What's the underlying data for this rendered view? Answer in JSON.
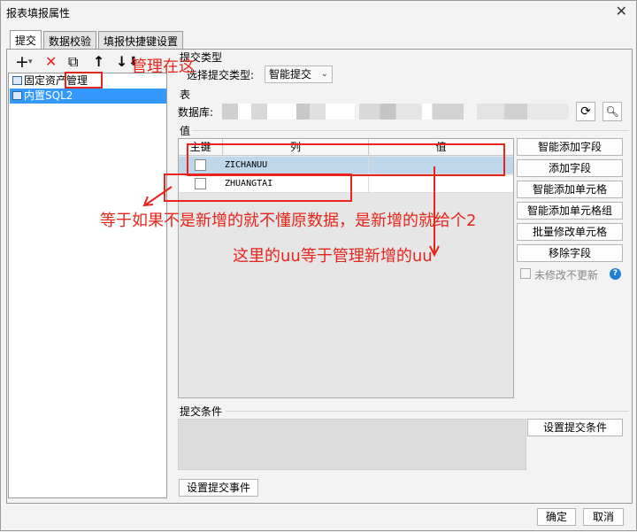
{
  "window": {
    "title": "报表填报属性",
    "close_icon": "✕"
  },
  "tabs": [
    "提交",
    "数据校验",
    "填报快捷键设置"
  ],
  "toolbar": {
    "add": "+",
    "add_caret": "▾",
    "delete": "✕",
    "copy": "⧉",
    "up": "↑",
    "down": "↓",
    "last": "⬇"
  },
  "tree": {
    "items": [
      "固定资产管理",
      "内置SQL2"
    ],
    "selected_index": 1
  },
  "submit_type": {
    "section": "提交类型",
    "label": "选择提交类型:",
    "value": "智能提交"
  },
  "table": {
    "section": "表",
    "db_label": "数据库:"
  },
  "values": {
    "section": "值",
    "columns": [
      "主键",
      "列",
      "值"
    ],
    "rows": [
      {
        "checked": false,
        "column": "ZICHANUU",
        "value": ""
      },
      {
        "checked": false,
        "column": "ZHUANGTAI",
        "value": ""
      }
    ]
  },
  "side_buttons": [
    "智能添加字段",
    "添加字段",
    "智能添加单元格",
    "智能添加单元格组",
    "批量修改单元格",
    "移除字段"
  ],
  "no_update_label": "未修改不更新",
  "help_icon": "?",
  "submit_condition": {
    "section": "提交条件",
    "button": "设置提交条件"
  },
  "submit_event_button": "设置提交事件",
  "footer": {
    "ok": "确定",
    "cancel": "取消"
  },
  "annotations": {
    "tree_note": "管理在这",
    "row_note": "等于如果不是新增的就不懂原数据，是新增的就给个2",
    "value_note": "这里的uu等于管理新增的uu"
  },
  "colors": {
    "annotation": "#e8251c",
    "selection": "#3399ff",
    "row_selected": "#bfd7ea"
  }
}
